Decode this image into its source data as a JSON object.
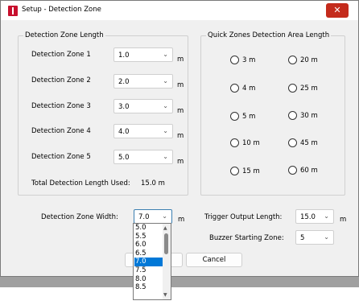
{
  "window": {
    "title": "Setup - Detection Zone",
    "close_glyph": "✕"
  },
  "detection_zone_length": {
    "legend": "Detection Zone Length",
    "zones": [
      {
        "label": "Detection Zone 1",
        "value": "1.0",
        "unit": "m"
      },
      {
        "label": "Detection Zone 2",
        "value": "2.0",
        "unit": "m"
      },
      {
        "label": "Detection Zone 3",
        "value": "3.0",
        "unit": "m"
      },
      {
        "label": "Detection Zone 4",
        "value": "4.0",
        "unit": "m"
      },
      {
        "label": "Detection Zone 5",
        "value": "5.0",
        "unit": "m"
      }
    ],
    "total_label": "Total Detection Length Used:",
    "total_value": "15.0 m"
  },
  "quick_zones": {
    "legend": "Quick Zones Detection Area Length",
    "options": [
      "3 m",
      "20 m",
      "4 m",
      "25 m",
      "5 m",
      "30 m",
      "10 m",
      "45 m",
      "15 m",
      "60 m"
    ]
  },
  "settings": {
    "zone_width_label": "Detection Zone Width:",
    "zone_width_value": "7.0",
    "zone_width_unit": "m",
    "trigger_label": "Trigger Output Length:",
    "trigger_value": "15.0",
    "trigger_unit": "m",
    "buzzer_label": "Buzzer Starting Zone:",
    "buzzer_value": "5"
  },
  "dropdown": {
    "options": [
      "5.0",
      "5.5",
      "6.0",
      "6.5",
      "7.0",
      "7.5",
      "8.0",
      "8.5"
    ],
    "selected": "7.0"
  },
  "buttons": {
    "cancel_label": "Cancel"
  },
  "icons": {
    "chevron": "chevron-down-icon",
    "scroll_up": "scroll-up-arrow-icon",
    "scroll_down": "scroll-down-arrow-icon",
    "app": "app-logo-icon",
    "close": "close-icon"
  },
  "colors": {
    "selection": "#0078d7",
    "close_button": "#c42b1c",
    "app_icon": "#c8102e"
  }
}
